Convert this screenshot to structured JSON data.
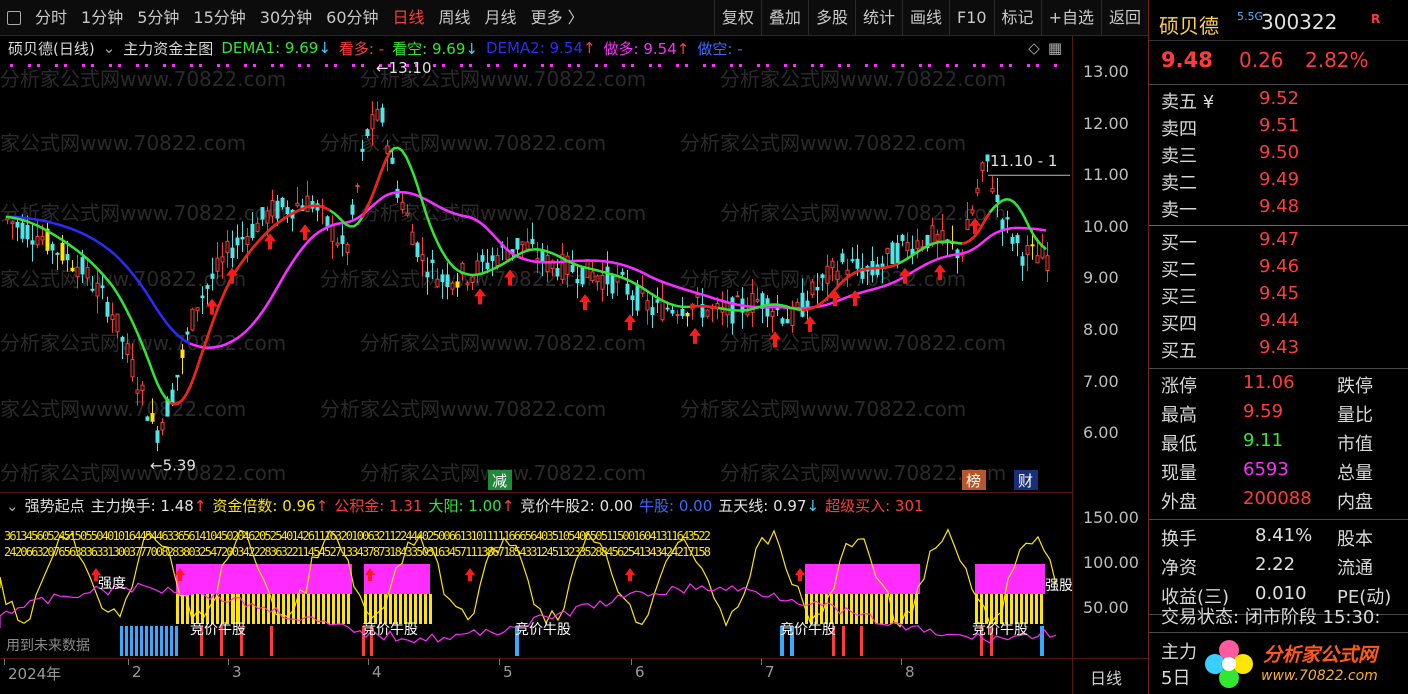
{
  "toolbar": {
    "tabs": [
      "分时",
      "1分钟",
      "5分钟",
      "15分钟",
      "30分钟",
      "60分钟",
      "日线",
      "周线",
      "月线",
      "更多 〉"
    ],
    "active_tab": "日线",
    "tools": [
      "复权",
      "叠加",
      "多股",
      "统计",
      "画线",
      "F10",
      "标记",
      "+自选",
      "返回"
    ]
  },
  "main_header": {
    "title": "硕贝德(日线)",
    "indicator": "主力资金主图",
    "dema1": "DEMA1: 9.69",
    "dema1_arrow": "↓",
    "kanduo": "看多: -",
    "kankong": "看空: 9.69",
    "kankong_arrow": "↓",
    "dema2": "DEMA2: 9.54",
    "dema2_arrow": "↑",
    "zuoduo": "做多: 9.54",
    "zuoduo_arrow": "↑",
    "zuokong": "做空: -",
    "diamond": "◇",
    "grid_icon": "grid-icon"
  },
  "main_chart": {
    "y_ticks": [
      "13.00",
      "12.00",
      "11.00",
      "10.00",
      "9.00",
      "8.00",
      "7.00",
      "6.00"
    ],
    "high_label": "13.10",
    "low_label": "5.39",
    "right_label": "11.10 - 1",
    "markers": [
      "减",
      "榜",
      "财"
    ],
    "watermark": "分析家公式网www.70822.com"
  },
  "sub_header": {
    "title": "强势起点",
    "items": [
      {
        "label": "主力换手: 1.48",
        "arrow": "↑",
        "color": "#e0e0e0",
        "acolor": "#ff3b3b"
      },
      {
        "label": "资金倍数: 0.96",
        "arrow": "↑",
        "color": "#ffe600",
        "acolor": "#ff3b3b"
      },
      {
        "label": "公积金: 1.31",
        "arrow": "",
        "color": "#ff3b3b",
        "acolor": "#ff3b3b"
      },
      {
        "label": "大阳: 1.00",
        "arrow": "↑",
        "color": "#31e831",
        "acolor": "#ff3b3b"
      },
      {
        "label": "竞价牛股2: 0.00",
        "arrow": "",
        "color": "#e0e0e0",
        "acolor": "#ff3b3b"
      },
      {
        "label": "牛股: 0.00",
        "arrow": "",
        "color": "#3a6bff",
        "acolor": "#ff3b3b"
      },
      {
        "label": "五天线: 0.97",
        "arrow": "↓",
        "color": "#e0e0e0",
        "acolor": "#39d0ff"
      },
      {
        "label": "超级买入: 301",
        "arrow": "",
        "color": "#ff3b3b",
        "acolor": "#ff3b3b"
      }
    ]
  },
  "sub_chart": {
    "y_ticks": [
      "150.00",
      "100.00",
      "50.00"
    ],
    "labels": [
      "强度",
      "竞价牛股",
      "竞价牛股",
      "竞价牛股",
      "竞价牛股",
      "竞价牛股",
      "强股"
    ],
    "bottom_text": "用到未来数据"
  },
  "x_axis": {
    "ticks": [
      "2024年",
      "2",
      "3",
      "4",
      "5",
      "6",
      "7",
      "8"
    ],
    "period": "日线"
  },
  "quote": {
    "name": "硕贝德",
    "tag": "5.5G",
    "code": "300322",
    "r": "R",
    "price": "9.48",
    "change": "0.26",
    "pct": "2.82%",
    "sell": [
      {
        "label": "卖五 ¥",
        "price": "9.52"
      },
      {
        "label": "卖四",
        "price": "9.51"
      },
      {
        "label": "卖三",
        "price": "9.50"
      },
      {
        "label": "卖二",
        "price": "9.49"
      },
      {
        "label": "卖一",
        "price": "9.48"
      }
    ],
    "buy": [
      {
        "label": "买一",
        "price": "9.47"
      },
      {
        "label": "买二",
        "price": "9.46"
      },
      {
        "label": "买三",
        "price": "9.45"
      },
      {
        "label": "买四",
        "price": "9.44"
      },
      {
        "label": "买五",
        "price": "9.43"
      }
    ],
    "stats1": [
      {
        "label": "涨停",
        "value": "11.06",
        "color": "#ff3b3b",
        "label2": "跌停"
      },
      {
        "label": "最高",
        "value": "9.59",
        "color": "#ff3b3b",
        "label2": "量比"
      },
      {
        "label": "最低",
        "value": "9.11",
        "color": "#31e831",
        "label2": "市值"
      },
      {
        "label": "现量",
        "value": "6593",
        "color": "#ff2bff",
        "label2": "总量"
      },
      {
        "label": "外盘",
        "value": "200088",
        "color": "#ff3b3b",
        "label2": "内盘"
      }
    ],
    "stats2": [
      {
        "label": "换手",
        "value": "8.41%",
        "label2": "股本"
      },
      {
        "label": "净资",
        "value": "2.22",
        "label2": "流通"
      },
      {
        "label": "收益(三)",
        "value": "0.010",
        "label2": "PE(动)"
      }
    ],
    "status": "交易状态: 闭市阶段 15:30:",
    "extra1": "主力",
    "extra2": "5日",
    "logo_text": "分析家公式网",
    "logo_url": "www.70822.com"
  },
  "colors": {
    "up": "#ff3b3b",
    "down": "#4ee6e6",
    "dema1": "#31e831",
    "dema2": "#2b2bff",
    "red_line": "#ff1a1a",
    "magenta": "#ff2bff",
    "yellow": "#ffe600"
  }
}
